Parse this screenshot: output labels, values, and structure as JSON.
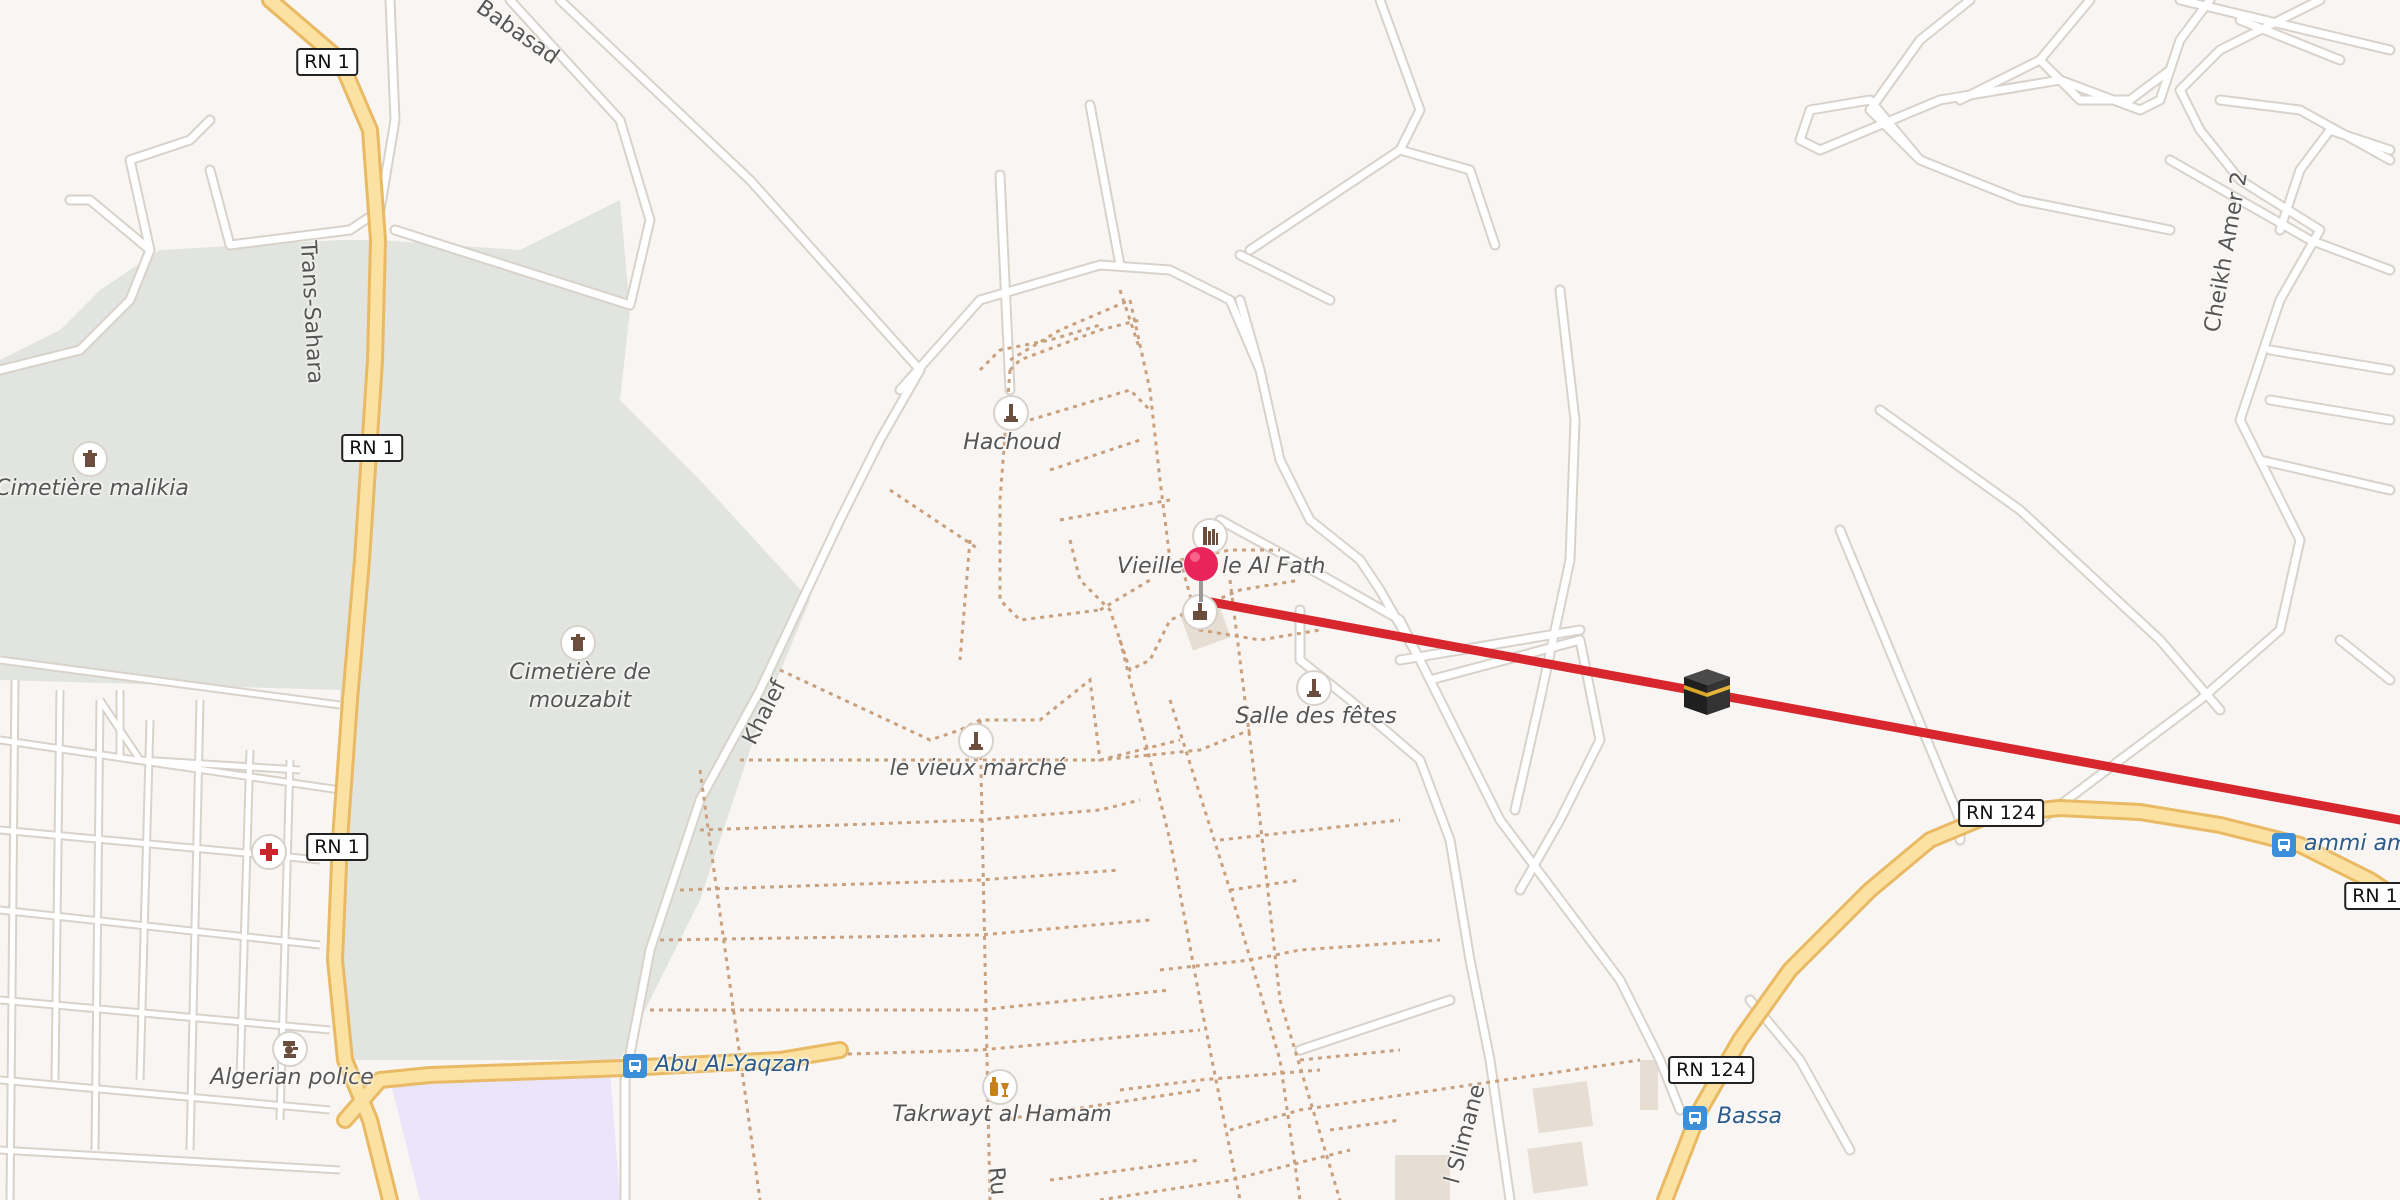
{
  "map": {
    "colors": {
      "background": "#f8f5f2",
      "park": "#e2e5df",
      "primary_road": "#fbe2a3",
      "primary_casing": "#e9b963",
      "minor_road": "#ffffff",
      "minor_casing": "#d8d2ca",
      "path": "#c9a07e",
      "route_line": "#d7262d",
      "pin": "#e8245a",
      "bus_stop": "#3b8fd8",
      "institutional": "#ebe5fb"
    },
    "route_shields": {
      "rn1_top": "RN 1",
      "rn1_mid": "RN 1",
      "rn1_lower": "RN 1",
      "rn1_right": "RN 1",
      "rn124_right": "RN 124",
      "rn124_bottom": "RN 124"
    },
    "road_names": {
      "trans_sahara": "Trans-Sahara",
      "babasad": "Babasad",
      "khalef": "Khalef",
      "cheikh_amer": "Cheikh Amer 2",
      "slimane": "l Slimane",
      "ru": "Ru"
    },
    "places": {
      "cimetiere_malikia": "Cimetière malikia",
      "cimetiere_mouzabit_line1": "Cimetière de",
      "cimetiere_mouzabit_line2": "mouzabit",
      "hachoud": "Hachoud",
      "vieille_ville": "Vieille",
      "vieille_ville_rest": "le Al Fath",
      "salle_des_fetes": "Salle des fêtes",
      "vieux_marche": "le vieux marché",
      "algerian_police": "Algerian police",
      "takrwayt": "Takrwayt al Hamam"
    },
    "transit": {
      "abu_al_yaqzan": "Abu Al-Yaqzan",
      "bassa": "Bassa",
      "ammi": "ammi am"
    },
    "icons": {
      "cemetery": "cemetery-icon",
      "monument": "monument-icon",
      "hospital": "hospital-cross-icon",
      "police": "police-icon",
      "bar": "bottle-glass-icon",
      "bus": "bus-stop-icon",
      "pin": "location-pin-icon",
      "kaaba": "kaaba-icon",
      "building": "building-icon"
    }
  }
}
